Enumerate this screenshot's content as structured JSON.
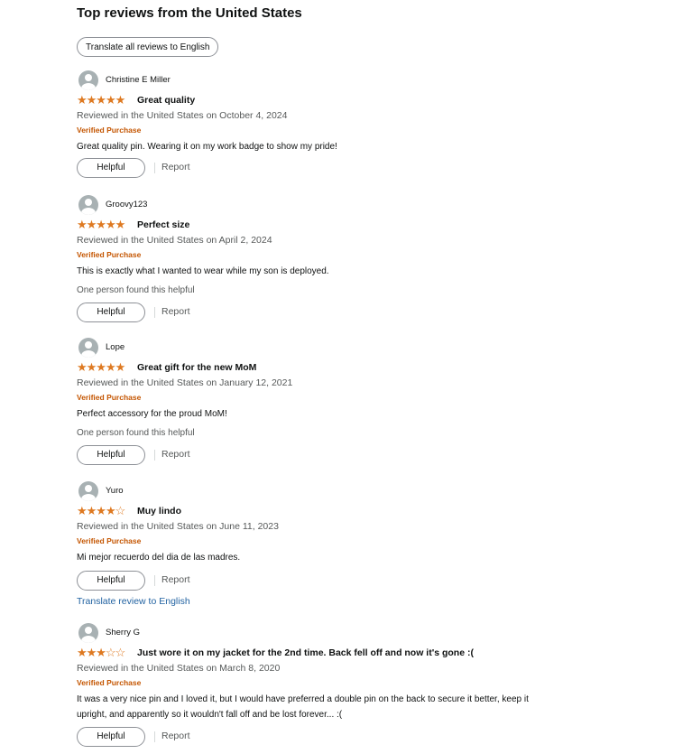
{
  "heading": "Top reviews from the United States",
  "translate_all_label": "Translate all reviews to English",
  "helpful_label": "Helpful",
  "report_label": "Report",
  "colors": {
    "star": "#de7921",
    "verified": "#c45500",
    "link": "#2162a1",
    "muted": "#565959"
  },
  "reviews": [
    {
      "name": "Christine E Miller",
      "rating": 5,
      "stars_text": "★★★★★",
      "title": "Great quality",
      "date": "Reviewed in the United States on October 4, 2024",
      "verified": "Verified Purchase",
      "body": "Great quality pin. Wearing it on my work badge to show my pride!"
    },
    {
      "name": "Groovy123",
      "rating": 5,
      "stars_text": "★★★★★",
      "title": "Perfect size",
      "date": "Reviewed in the United States on April 2, 2024",
      "verified": "Verified Purchase",
      "body": "This is exactly what I wanted to wear while my son is deployed.",
      "helpful_count": "One person found this helpful"
    },
    {
      "name": "Lope",
      "rating": 5,
      "stars_text": "★★★★★",
      "title": "Great gift for the new MoM",
      "date": "Reviewed in the United States on January 12, 2021",
      "verified": "Verified Purchase",
      "body": "Perfect accessory for the proud MoM!",
      "helpful_count": "One person found this helpful"
    },
    {
      "name": "Yuro",
      "rating": 4,
      "stars_full": "★★★★",
      "stars_empty": "☆",
      "title": "Muy lindo",
      "date": "Reviewed in the United States on June 11, 2023",
      "verified": "Verified Purchase",
      "body": "Mi mejor recuerdo del dia de las madres.",
      "translate_link": "Translate review to English"
    },
    {
      "name": "Sherry G",
      "rating": 3,
      "stars_full": "★★★",
      "stars_empty": "☆☆",
      "title": "Just wore it on my jacket for the 2nd time. Back fell off and now it's gone :(",
      "date": "Reviewed in the United States on March 8, 2020",
      "verified": "Verified Purchase",
      "body": "It was a very nice pin and I loved it, but I would have preferred a double pin on the back to secure it better, keep it upright, and apparently so it wouldn't fall off and be lost forever... :("
    }
  ]
}
